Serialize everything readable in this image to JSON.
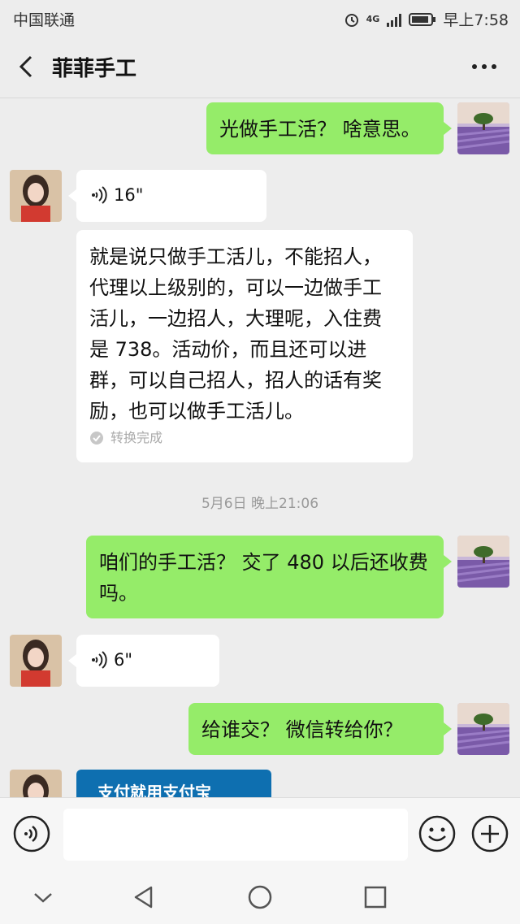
{
  "status": {
    "carrier": "中国联通",
    "time": "早上7:58",
    "network": "4G"
  },
  "header": {
    "title": "菲菲手工"
  },
  "messages": [
    {
      "side": "right",
      "text": "光做手工活？ 啥意思。"
    },
    {
      "side": "left",
      "voice": "16\""
    },
    {
      "side": "left",
      "text": "就是说只做手工活儿，不能招人，代理以上级别的，可以一边做手工活儿，一边招人，大理呢，入住费是 738。活动价，而且还可以进群，可以自己招人，招人的话有奖励，也可以做手工活儿。",
      "note": "转换完成"
    },
    {
      "timestamp": "5月6日 晚上21:06"
    },
    {
      "side": "right",
      "text": "咱们的手工活？ 交了 480 以后还收费吗。"
    },
    {
      "side": "left",
      "voice": "6\""
    },
    {
      "side": "right",
      "text": "给谁交？ 微信转给你？"
    },
    {
      "side": "left",
      "card": "支付就用支付宝"
    }
  ],
  "icons": {
    "back": "chevron-left-icon",
    "more": "more-dots-icon",
    "voice": "voice-icon",
    "emoji": "emoji-icon",
    "plus": "plus-icon",
    "nav_down": "chevron-down-icon",
    "nav_back": "triangle-back-icon",
    "nav_home": "circle-home-icon",
    "nav_recent": "square-recent-icon"
  },
  "colors": {
    "sent_bubble": "#95ec69",
    "received_bubble": "#ffffff",
    "background": "#ededed"
  }
}
